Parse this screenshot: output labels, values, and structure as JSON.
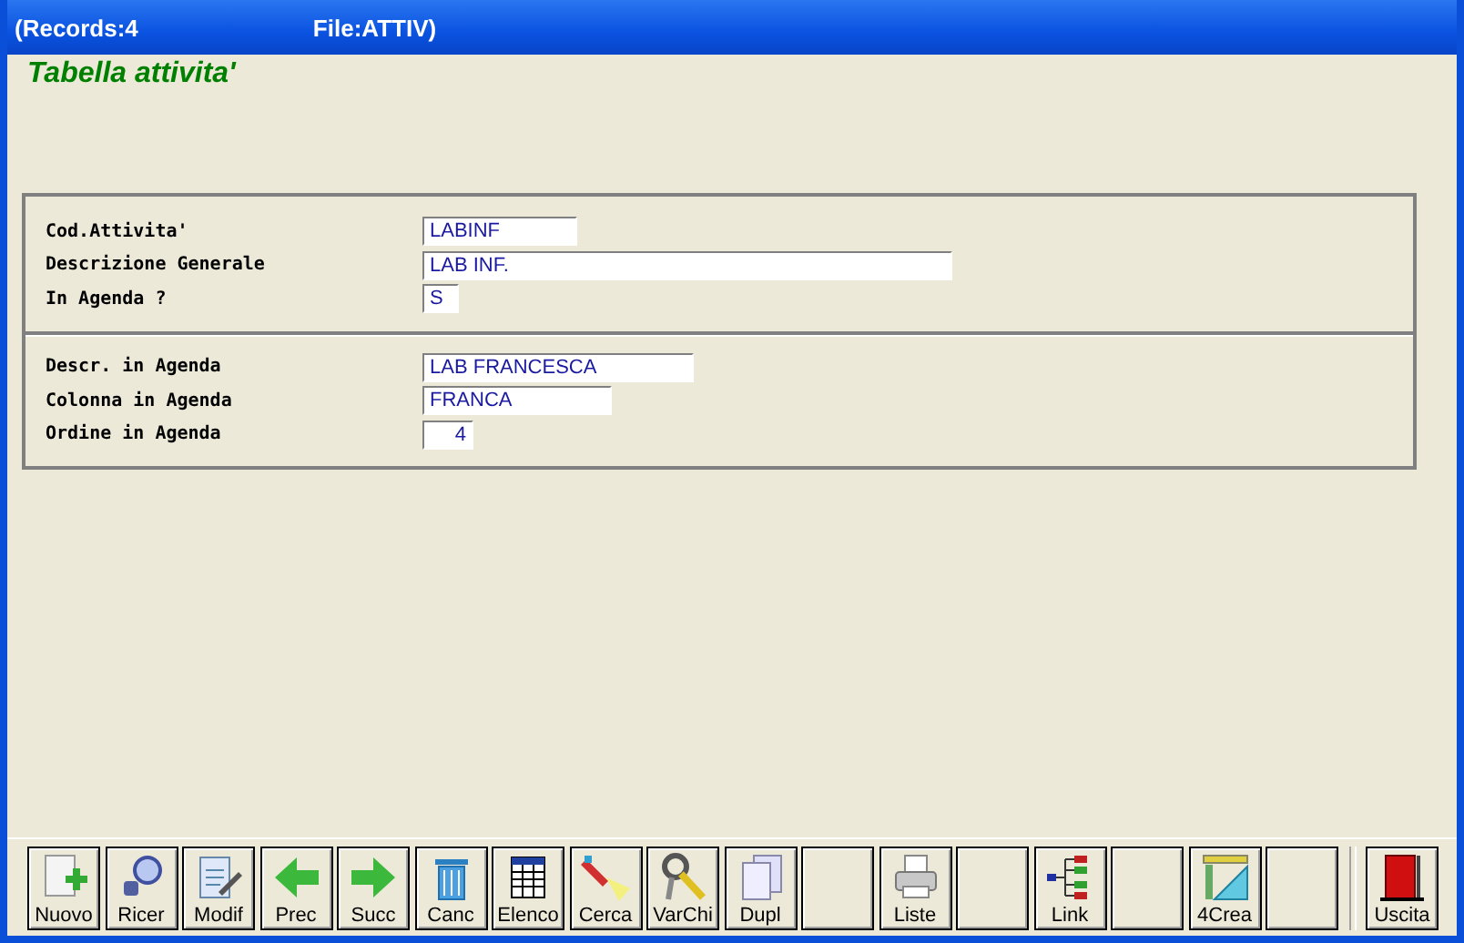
{
  "window": {
    "title": "(Records:4",
    "title_file": "File:ATTIV)"
  },
  "heading": "Tabella attivita'",
  "sections": [
    {
      "fields": [
        {
          "label": "Cod.Attivita'",
          "value": "LABINF"
        },
        {
          "label": "Descrizione Generale",
          "value": "LAB INF."
        },
        {
          "label": "In Agenda ?",
          "value": "S"
        }
      ]
    },
    {
      "fields": [
        {
          "label": "Descr. in Agenda",
          "value": "LAB FRANCESCA"
        },
        {
          "label": "Colonna in Agenda",
          "value": "FRANCA"
        },
        {
          "label": "Ordine in Agenda",
          "value": "4"
        }
      ]
    }
  ],
  "toolbar": [
    {
      "kind": "button",
      "label": "Nuovo"
    },
    {
      "kind": "button",
      "label": "Ricer"
    },
    {
      "kind": "button",
      "label": "Modif"
    },
    {
      "kind": "button",
      "label": "Prec"
    },
    {
      "kind": "button",
      "label": "Succ"
    },
    {
      "kind": "button",
      "label": "Canc"
    },
    {
      "kind": "button",
      "label": "Elenco"
    },
    {
      "kind": "button",
      "label": "Cerca"
    },
    {
      "kind": "button",
      "label": "VarChi"
    },
    {
      "kind": "button",
      "label": "Dupl"
    },
    {
      "kind": "blank"
    },
    {
      "kind": "button",
      "label": "Liste"
    },
    {
      "kind": "blank"
    },
    {
      "kind": "button",
      "label": "Link"
    },
    {
      "kind": "blank"
    },
    {
      "kind": "button",
      "label": "4Crea"
    },
    {
      "kind": "blank"
    },
    {
      "kind": "separator"
    },
    {
      "kind": "button",
      "label": "Uscita"
    }
  ]
}
